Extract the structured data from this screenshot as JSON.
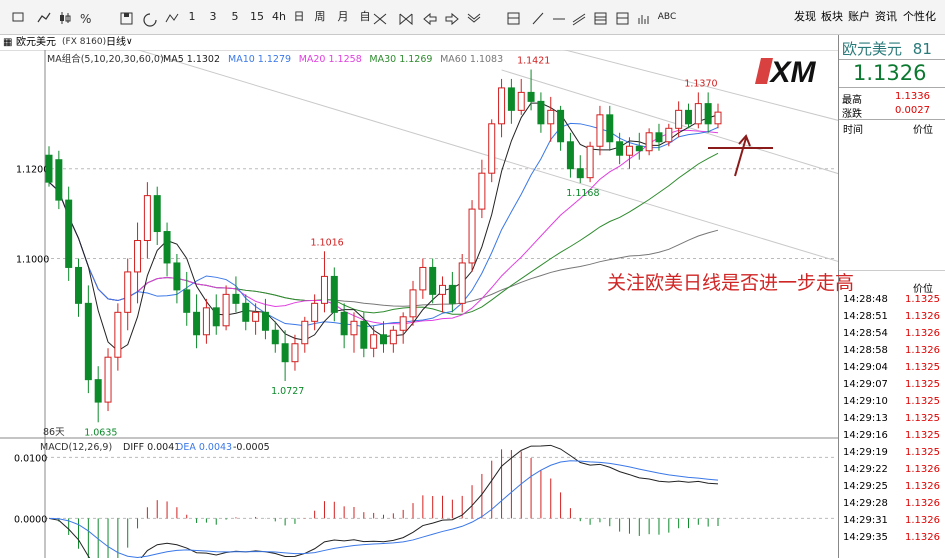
{
  "toolbar": {
    "icons": [
      "app-icon",
      "line-chart-icon",
      "candlestick-icon",
      "stock-icon",
      "save-icon",
      "refresh-icon",
      "indicator-icon"
    ],
    "periods": [
      "1",
      "3",
      "5",
      "15",
      "4h",
      "日",
      "周",
      "月",
      "自"
    ],
    "draw_icons": [
      "zoom-in-icon",
      "zoom-out-icon",
      "arrow-left-icon",
      "arrow-right-icon",
      "arrow-updown-icon",
      "layout-icon",
      "line-icon",
      "hline-icon",
      "parallel-icon",
      "rect-icon",
      "channel-icon",
      "volume-icon"
    ],
    "abc": "ABC",
    "menu": [
      "发现",
      "板块",
      "账户",
      "资讯",
      "个性化"
    ]
  },
  "subheader": {
    "symbol": "欧元美元",
    "code": "(FX 8160)",
    "period": "日线",
    "ma_label": "MA组合(5,10,20,30,60,0)",
    "ma_values": [
      {
        "text": "MA5 1.1302",
        "color": "#222222"
      },
      {
        "text": "MA10 1.1279",
        "color": "#3b78e7"
      },
      {
        "text": "MA20 1.1258",
        "color": "#e040e0"
      },
      {
        "text": "MA30 1.1269",
        "color": "#2e8b2e"
      },
      {
        "text": "MA60 1.1083",
        "color": "#777777"
      }
    ]
  },
  "chart_data": {
    "type": "candlestick",
    "ylim": [
      1.06,
      1.146
    ],
    "y_ticks": [
      "1.1200",
      "1.1000"
    ],
    "y_tick_values": [
      1.12,
      1.1
    ],
    "candles": [
      {
        "o": 1.123,
        "h": 1.125,
        "l": 1.116,
        "c": 1.117
      },
      {
        "o": 1.122,
        "h": 1.124,
        "l": 1.111,
        "c": 1.113
      },
      {
        "o": 1.113,
        "h": 1.116,
        "l": 1.095,
        "c": 1.098
      },
      {
        "o": 1.098,
        "h": 1.1,
        "l": 1.087,
        "c": 1.09
      },
      {
        "o": 1.09,
        "h": 1.094,
        "l": 1.07,
        "c": 1.073
      },
      {
        "o": 1.073,
        "h": 1.076,
        "l": 1.0635,
        "c": 1.068
      },
      {
        "o": 1.068,
        "h": 1.08,
        "l": 1.066,
        "c": 1.078
      },
      {
        "o": 1.078,
        "h": 1.09,
        "l": 1.075,
        "c": 1.088
      },
      {
        "o": 1.088,
        "h": 1.1,
        "l": 1.084,
        "c": 1.097
      },
      {
        "o": 1.097,
        "h": 1.108,
        "l": 1.09,
        "c": 1.104
      },
      {
        "o": 1.104,
        "h": 1.117,
        "l": 1.1,
        "c": 1.114
      },
      {
        "o": 1.114,
        "h": 1.116,
        "l": 1.103,
        "c": 1.106
      },
      {
        "o": 1.106,
        "h": 1.108,
        "l": 1.096,
        "c": 1.099
      },
      {
        "o": 1.099,
        "h": 1.101,
        "l": 1.09,
        "c": 1.093
      },
      {
        "o": 1.093,
        "h": 1.097,
        "l": 1.085,
        "c": 1.088
      },
      {
        "o": 1.088,
        "h": 1.092,
        "l": 1.08,
        "c": 1.083
      },
      {
        "o": 1.083,
        "h": 1.091,
        "l": 1.081,
        "c": 1.089
      },
      {
        "o": 1.089,
        "h": 1.092,
        "l": 1.083,
        "c": 1.085
      },
      {
        "o": 1.085,
        "h": 1.094,
        "l": 1.084,
        "c": 1.092
      },
      {
        "o": 1.092,
        "h": 1.096,
        "l": 1.088,
        "c": 1.09
      },
      {
        "o": 1.09,
        "h": 1.092,
        "l": 1.084,
        "c": 1.086
      },
      {
        "o": 1.086,
        "h": 1.09,
        "l": 1.083,
        "c": 1.088
      },
      {
        "o": 1.088,
        "h": 1.091,
        "l": 1.082,
        "c": 1.084
      },
      {
        "o": 1.084,
        "h": 1.086,
        "l": 1.079,
        "c": 1.081
      },
      {
        "o": 1.081,
        "h": 1.084,
        "l": 1.0727,
        "c": 1.077
      },
      {
        "o": 1.077,
        "h": 1.083,
        "l": 1.075,
        "c": 1.081
      },
      {
        "o": 1.081,
        "h": 1.087,
        "l": 1.079,
        "c": 1.086
      },
      {
        "o": 1.086,
        "h": 1.092,
        "l": 1.084,
        "c": 1.09
      },
      {
        "o": 1.09,
        "h": 1.1016,
        "l": 1.088,
        "c": 1.096
      },
      {
        "o": 1.096,
        "h": 1.098,
        "l": 1.086,
        "c": 1.088
      },
      {
        "o": 1.088,
        "h": 1.09,
        "l": 1.08,
        "c": 1.083
      },
      {
        "o": 1.083,
        "h": 1.088,
        "l": 1.079,
        "c": 1.086
      },
      {
        "o": 1.086,
        "h": 1.088,
        "l": 1.078,
        "c": 1.08
      },
      {
        "o": 1.08,
        "h": 1.085,
        "l": 1.078,
        "c": 1.083
      },
      {
        "o": 1.083,
        "h": 1.086,
        "l": 1.079,
        "c": 1.081
      },
      {
        "o": 1.081,
        "h": 1.085,
        "l": 1.079,
        "c": 1.084
      },
      {
        "o": 1.084,
        "h": 1.088,
        "l": 1.081,
        "c": 1.087
      },
      {
        "o": 1.087,
        "h": 1.095,
        "l": 1.085,
        "c": 1.093
      },
      {
        "o": 1.093,
        "h": 1.1,
        "l": 1.091,
        "c": 1.098
      },
      {
        "o": 1.098,
        "h": 1.1,
        "l": 1.09,
        "c": 1.092
      },
      {
        "o": 1.092,
        "h": 1.096,
        "l": 1.088,
        "c": 1.094
      },
      {
        "o": 1.094,
        "h": 1.097,
        "l": 1.088,
        "c": 1.09
      },
      {
        "o": 1.09,
        "h": 1.101,
        "l": 1.088,
        "c": 1.099
      },
      {
        "o": 1.099,
        "h": 1.113,
        "l": 1.097,
        "c": 1.111
      },
      {
        "o": 1.111,
        "h": 1.122,
        "l": 1.109,
        "c": 1.119
      },
      {
        "o": 1.119,
        "h": 1.131,
        "l": 1.117,
        "c": 1.13
      },
      {
        "o": 1.13,
        "h": 1.14,
        "l": 1.127,
        "c": 1.138
      },
      {
        "o": 1.138,
        "h": 1.14,
        "l": 1.13,
        "c": 1.133
      },
      {
        "o": 1.133,
        "h": 1.14,
        "l": 1.132,
        "c": 1.137
      },
      {
        "o": 1.137,
        "h": 1.1421,
        "l": 1.133,
        "c": 1.135
      },
      {
        "o": 1.135,
        "h": 1.137,
        "l": 1.128,
        "c": 1.13
      },
      {
        "o": 1.13,
        "h": 1.136,
        "l": 1.126,
        "c": 1.133
      },
      {
        "o": 1.133,
        "h": 1.134,
        "l": 1.124,
        "c": 1.126
      },
      {
        "o": 1.126,
        "h": 1.128,
        "l": 1.118,
        "c": 1.12
      },
      {
        "o": 1.12,
        "h": 1.123,
        "l": 1.1168,
        "c": 1.118
      },
      {
        "o": 1.118,
        "h": 1.126,
        "l": 1.117,
        "c": 1.125
      },
      {
        "o": 1.125,
        "h": 1.134,
        "l": 1.123,
        "c": 1.132
      },
      {
        "o": 1.132,
        "h": 1.134,
        "l": 1.124,
        "c": 1.126
      },
      {
        "o": 1.126,
        "h": 1.128,
        "l": 1.121,
        "c": 1.123
      },
      {
        "o": 1.123,
        "h": 1.127,
        "l": 1.12,
        "c": 1.125
      },
      {
        "o": 1.125,
        "h": 1.128,
        "l": 1.122,
        "c": 1.124
      },
      {
        "o": 1.124,
        "h": 1.129,
        "l": 1.123,
        "c": 1.128
      },
      {
        "o": 1.128,
        "h": 1.13,
        "l": 1.124,
        "c": 1.126
      },
      {
        "o": 1.126,
        "h": 1.13,
        "l": 1.125,
        "c": 1.129
      },
      {
        "o": 1.129,
        "h": 1.135,
        "l": 1.127,
        "c": 1.133
      },
      {
        "o": 1.133,
        "h": 1.1345,
        "l": 1.129,
        "c": 1.13
      },
      {
        "o": 1.13,
        "h": 1.137,
        "l": 1.129,
        "c": 1.1345
      },
      {
        "o": 1.1345,
        "h": 1.137,
        "l": 1.128,
        "c": 1.13
      },
      {
        "o": 1.13,
        "h": 1.1345,
        "l": 1.129,
        "c": 1.1326
      }
    ],
    "annotations": [
      {
        "text": "1.1421",
        "idx": 49,
        "kind": "high"
      },
      {
        "text": "1.1370",
        "idx": 66,
        "kind": "high"
      },
      {
        "text": "1.1016",
        "idx": 28,
        "kind": "high"
      },
      {
        "text": "1.1168",
        "idx": 54,
        "kind": "low"
      },
      {
        "text": "1.0727",
        "idx": 24,
        "kind": "low"
      },
      {
        "text": "1.0635",
        "idx": 5,
        "kind": "low"
      }
    ],
    "bars_count_label": "86天",
    "note": "关注欧美日线是否进一步走高",
    "macd": {
      "label": "MACD(12,26,9)",
      "diff_label": "DIFF 0.0041",
      "dea_label": "DEA 0.0043",
      "hist_label": "-0.0005",
      "y_ticks": [
        "0.0100",
        "0.0000"
      ],
      "y_tick_values": [
        0.01,
        0.0
      ],
      "ylim": [
        -0.006,
        0.013
      ]
    }
  },
  "right_panel": {
    "title": "欧元美元",
    "code": "81",
    "price": "1.1326",
    "high_label": "最高",
    "high_value": "1.1336",
    "change_label": "涨跌",
    "change_value": "0.0027",
    "col_time": "时间",
    "col_price": "价位",
    "ticks": [
      {
        "time": "14:28:48",
        "price": "1.1325"
      },
      {
        "time": "14:28:51",
        "price": "1.1326"
      },
      {
        "time": "14:28:54",
        "price": "1.1326"
      },
      {
        "time": "14:28:58",
        "price": "1.1326"
      },
      {
        "time": "14:29:04",
        "price": "1.1325"
      },
      {
        "time": "14:29:07",
        "price": "1.1325"
      },
      {
        "time": "14:29:10",
        "price": "1.1325"
      },
      {
        "time": "14:29:13",
        "price": "1.1325"
      },
      {
        "time": "14:29:16",
        "price": "1.1325"
      },
      {
        "time": "14:29:19",
        "price": "1.1325"
      },
      {
        "time": "14:29:22",
        "price": "1.1326"
      },
      {
        "time": "14:29:25",
        "price": "1.1326"
      },
      {
        "time": "14:29:28",
        "price": "1.1326"
      },
      {
        "time": "14:29:31",
        "price": "1.1326"
      },
      {
        "time": "14:29:35",
        "price": "1.1326"
      }
    ]
  },
  "logo": "XM",
  "colors": {
    "up": "#d22020",
    "down": "#0c8a2a",
    "ma5": "#222222",
    "ma10": "#3b78e7",
    "ma20": "#e040e0",
    "ma30": "#2e8b2e",
    "ma60": "#777777",
    "arrow": "#8b1a1a"
  }
}
